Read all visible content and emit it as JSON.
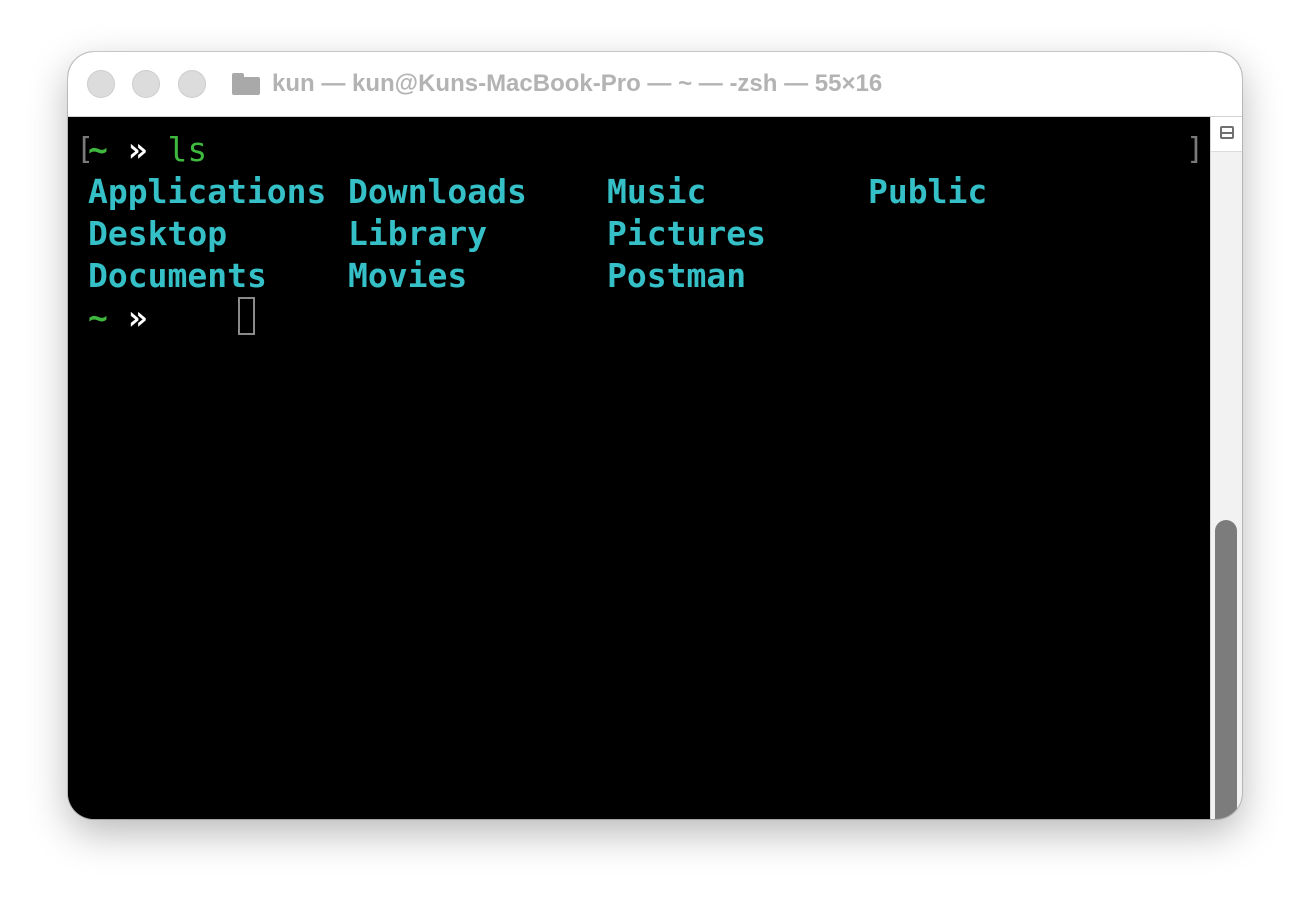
{
  "window": {
    "title": "kun — kun@Kuns-MacBook-Pro — ~ — -zsh — 55×16"
  },
  "terminal": {
    "prompt_tilde": "~",
    "prompt_arrow": "»",
    "command": "ls",
    "bracket_open": "[",
    "bracket_close": "]",
    "listing": [
      "Applications",
      "Downloads",
      "Music",
      "Public",
      "Desktop",
      "Library",
      "Pictures",
      "Documents",
      "Movies",
      "Postman"
    ]
  },
  "colors": {
    "prompt_green": "#3fb83f",
    "directory_cyan": "#35bfc6",
    "background": "#000000"
  },
  "icons": {
    "title": "folder-icon",
    "scroll": "split-pane-icon"
  }
}
